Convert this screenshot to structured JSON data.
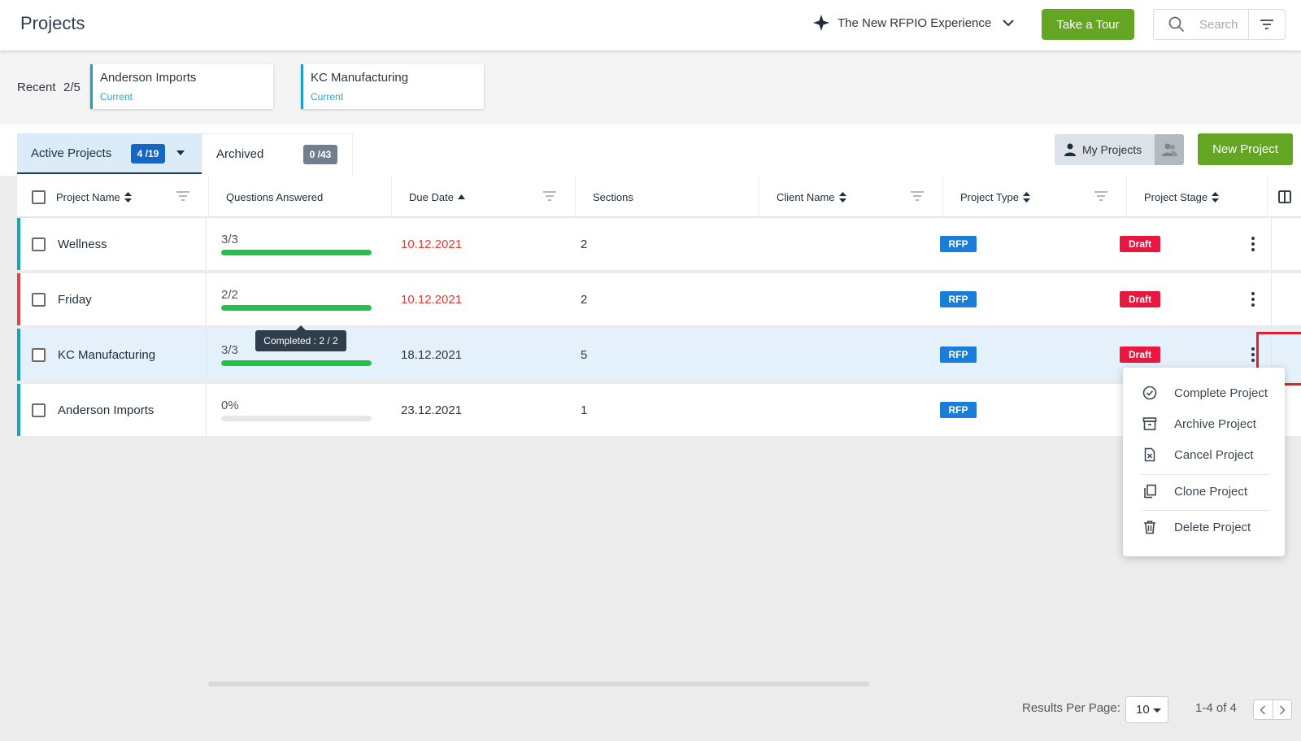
{
  "header": {
    "title": "Projects",
    "experience_label": "The New RFPIO Experience",
    "tour_label": "Take a Tour",
    "search_placeholder": "Search"
  },
  "recent": {
    "label": "Recent",
    "count": "2/5",
    "items": [
      {
        "name": "Anderson Imports",
        "status": "Current"
      },
      {
        "name": "KC Manufacturing",
        "status": "Current"
      }
    ]
  },
  "tabs": {
    "active": {
      "label": "Active Projects",
      "badge": "4 /19"
    },
    "archived": {
      "label": "Archived",
      "badge": "0 /43"
    },
    "my_projects_label": "My Projects",
    "new_project_label": "New Project"
  },
  "columns": {
    "project_name": "Project Name",
    "questions_answered": "Questions Answered",
    "due_date": "Due Date",
    "sections": "Sections",
    "client_name": "Client Name",
    "project_type": "Project Type",
    "project_stage": "Project Stage"
  },
  "rows": [
    {
      "name": "Wellness",
      "qa": "3/3",
      "progress": 1.0,
      "due": "10.12.2021",
      "overdue": true,
      "sections": "2",
      "client": "",
      "type": "RFP",
      "stage": "Draft",
      "color": "#17a2c2"
    },
    {
      "name": "Friday",
      "qa": "2/2",
      "progress": 1.0,
      "due": "10.12.2021",
      "overdue": true,
      "sections": "2",
      "client": "",
      "type": "RFP",
      "stage": "Draft",
      "color": "#e04444"
    },
    {
      "name": "KC Manufacturing",
      "qa": "3/3",
      "progress": 1.0,
      "due": "18.12.2021",
      "overdue": false,
      "sections": "5",
      "client": "",
      "type": "RFP",
      "stage": "Draft",
      "color": "#17a2c2"
    },
    {
      "name": "Anderson Imports",
      "qa": "0%",
      "progress": 0.0,
      "due": "23.12.2021",
      "overdue": false,
      "sections": "1",
      "client": "",
      "type": "RFP",
      "stage": "",
      "color": "#17a2c2"
    }
  ],
  "tooltip": "Completed : 2 / 2",
  "menu": {
    "items": [
      {
        "label": "Complete Project",
        "icon": "check-circle-icon"
      },
      {
        "label": "Archive Project",
        "icon": "archive-icon"
      },
      {
        "label": "Cancel Project",
        "icon": "file-x-icon"
      },
      {
        "label": "Clone Project",
        "icon": "copy-icon"
      },
      {
        "label": "Delete Project",
        "icon": "trash-icon"
      }
    ]
  },
  "footer": {
    "rpp_label": "Results Per Page:",
    "rpp_value": "10",
    "range": "1-4 of 4"
  },
  "colors": {
    "accent_green": "#64a524",
    "primary_blue": "#1667c5",
    "rfp_blue": "#1a7ed8",
    "draft_red": "#e8173f",
    "overdue_red": "#e53935",
    "progress_green": "#23c14a"
  }
}
